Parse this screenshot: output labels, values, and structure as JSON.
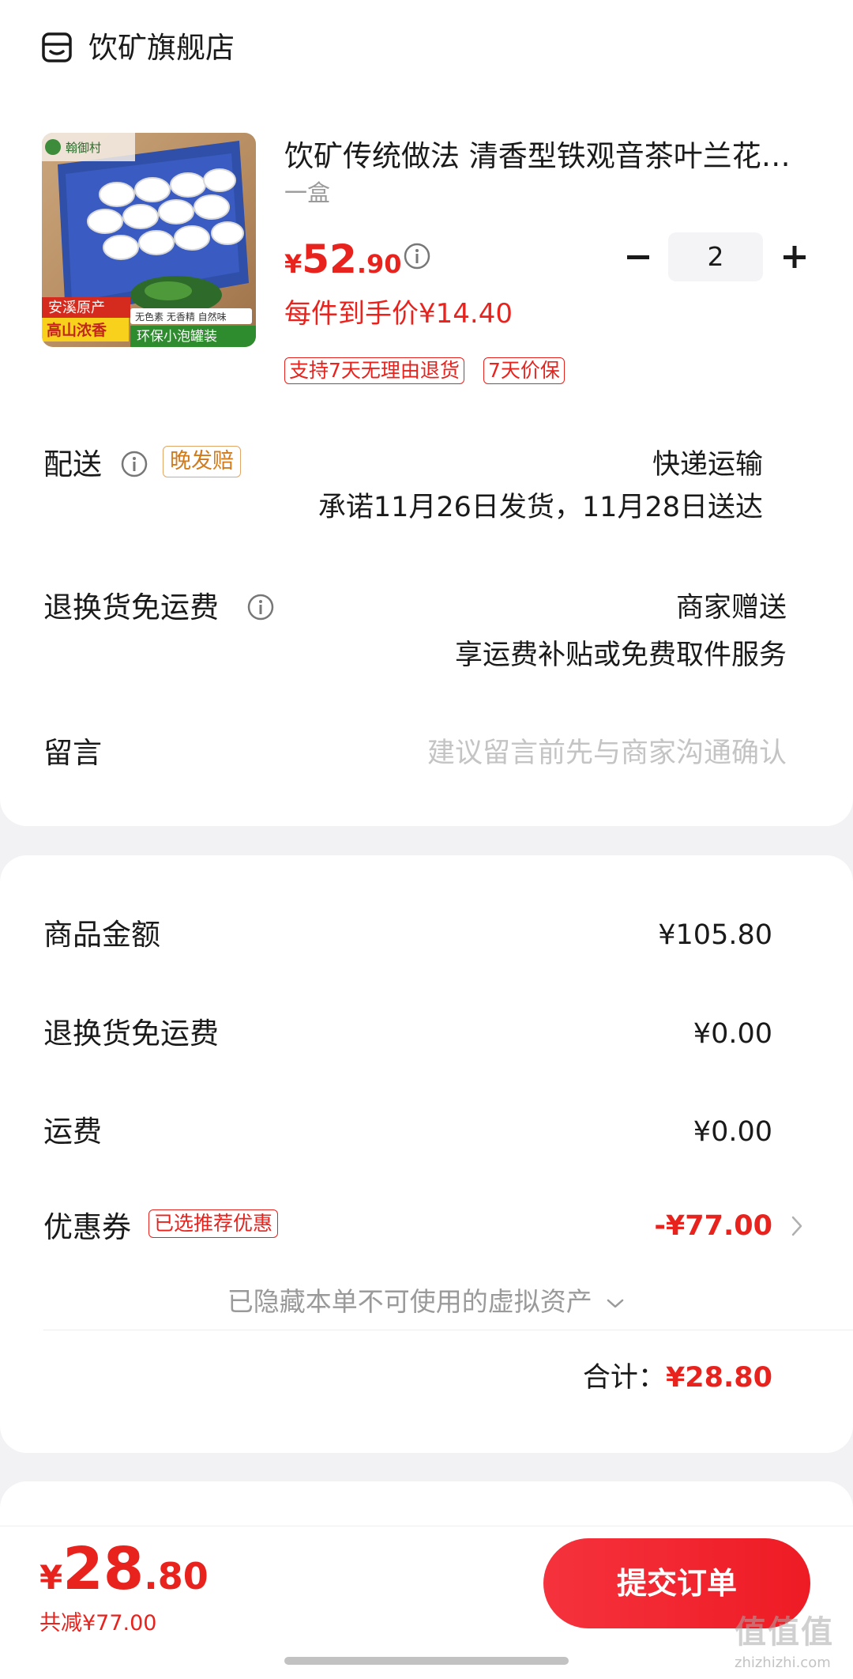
{
  "store": {
    "name": "饮矿旗舰店",
    "icon": "store-icon"
  },
  "product": {
    "title": "饮矿传统做法 清香型铁观音茶叶兰花香浓香型乌龙茶新茶礼盒装",
    "spec": "一盒",
    "image_labels": {
      "brand": "翰御村",
      "origin": "安溪原产",
      "slogan": "高山浓香",
      "features": "无色素 无香精 自然味",
      "package": "环保小泡罐装"
    },
    "price": {
      "currency": "¥",
      "integer": "52",
      "decimal": ".90"
    },
    "unit_price": "每件到手价¥14.40",
    "quantity": "2",
    "tags": [
      "支持7天无理由退货",
      "7天价保"
    ]
  },
  "delivery": {
    "label": "配送",
    "badge": "晚发赔",
    "method": "快递运输",
    "promise": "承诺11月26日发货，11月28日送达"
  },
  "return_shipping": {
    "label": "退换货免运费",
    "value": "商家赠送",
    "desc": "享运费补贴或免费取件服务"
  },
  "message": {
    "label": "留言",
    "placeholder": "建议留言前先与商家沟通确认"
  },
  "summary": {
    "goods_label": "商品金额",
    "goods_value": "¥105.80",
    "return_label": "退换货免运费",
    "return_value": "¥0.00",
    "shipping_label": "运费",
    "shipping_value": "¥0.00",
    "coupon_label": "优惠券",
    "coupon_badge": "已选推荐优惠",
    "coupon_value": "-¥77.00",
    "hidden_assets": "已隐藏本单不可使用的虚拟资产",
    "total_label": "合计：",
    "total_value": "¥28.80"
  },
  "bottom_bar": {
    "price": {
      "currency": "¥",
      "integer": "28",
      "decimal": ".80"
    },
    "discount": "共减¥77.00",
    "submit_label": "提交订单"
  },
  "watermark": {
    "text": "值值值",
    "url": "zhizhizhi.com"
  },
  "colors": {
    "accent": "#e8231e",
    "late_badge": "#d07b1c",
    "background": "#f2f2f4"
  }
}
